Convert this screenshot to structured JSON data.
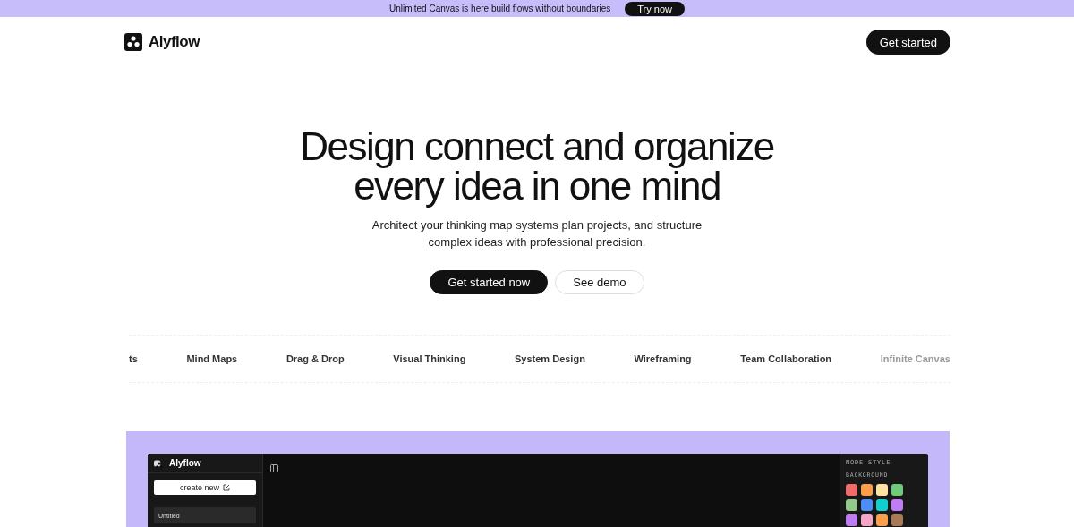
{
  "banner": {
    "text": "Unlimited Canvas is here build flows without boundaries",
    "action": "Try now"
  },
  "nav": {
    "brand": "Alyflow",
    "cta": "Get started"
  },
  "hero": {
    "title_lines": [
      "Design connect and organize",
      "every idea in one mind"
    ],
    "subtitle_lines": [
      "Architect your thinking map systems plan projects, and structure",
      "complex ideas with professional precision."
    ],
    "primary": "Get started now",
    "secondary": "See demo"
  },
  "marquee": [
    "ts",
    "Mind Maps",
    "Drag & Drop",
    "Visual Thinking",
    "System Design",
    "Wireframing",
    "Team Collaboration",
    "Infinite Canvas"
  ],
  "app_preview": {
    "brand": "Alyflow",
    "create_button": "create new",
    "documents": [
      "Untitled"
    ],
    "panel_title": "NODE STYLE",
    "panel_section": "BACKGROUND",
    "swatches": [
      {
        "color": "#f26b6b"
      },
      {
        "color": "#fb9f4a"
      },
      {
        "color": "#fde2a0"
      },
      {
        "color": "#6dcb7a"
      },
      {
        "color": "#94c98e"
      },
      {
        "color": "#4b8ef7"
      },
      {
        "color": "#12cfcf"
      },
      {
        "color": "#c07cf5"
      },
      {
        "color": "#c07cf5"
      },
      {
        "color": "#f5a6c8"
      },
      {
        "color": "#fb9f4a"
      },
      {
        "color": "#a97a55"
      }
    ]
  }
}
